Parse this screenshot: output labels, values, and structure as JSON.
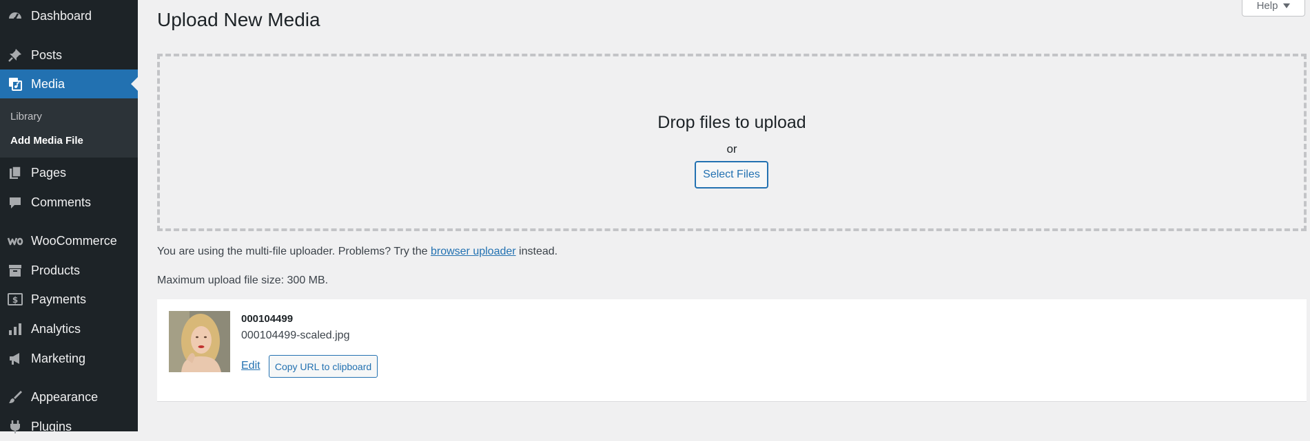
{
  "sidebar": {
    "items": [
      {
        "key": "dashboard",
        "label": "Dashboard",
        "icon": "dashboard-icon"
      },
      {
        "key": "posts",
        "label": "Posts",
        "icon": "pushpin-icon"
      },
      {
        "key": "media",
        "label": "Media",
        "icon": "media-icon"
      },
      {
        "key": "pages",
        "label": "Pages",
        "icon": "pages-icon"
      },
      {
        "key": "comments",
        "label": "Comments",
        "icon": "comment-icon"
      },
      {
        "key": "woocommerce",
        "label": "WooCommerce",
        "icon": "woocommerce-icon"
      },
      {
        "key": "products",
        "label": "Products",
        "icon": "archive-icon"
      },
      {
        "key": "payments",
        "label": "Payments",
        "icon": "money-icon"
      },
      {
        "key": "analytics",
        "label": "Analytics",
        "icon": "bar-chart-icon"
      },
      {
        "key": "marketing",
        "label": "Marketing",
        "icon": "megaphone-icon"
      },
      {
        "key": "appearance",
        "label": "Appearance",
        "icon": "paintbrush-icon"
      },
      {
        "key": "plugins",
        "label": "Plugins",
        "icon": "plug-icon"
      }
    ],
    "current": "Media",
    "submenu": {
      "library": "Library",
      "add_media": "Add Media File"
    }
  },
  "header": {
    "title": "Upload New Media",
    "help_label": "Help"
  },
  "uploader": {
    "drop_title": "Drop files to upload",
    "or_text": "or",
    "select_button": "Select Files",
    "info_prefix": "You are using the multi-file uploader. Problems? Try the",
    "info_link": "browser uploader",
    "info_suffix": "instead.",
    "max_size": "Maximum upload file size: 300 MB."
  },
  "media_item": {
    "title": "000104499",
    "filename": "000104499-scaled.jpg",
    "edit_label": "Edit",
    "copy_label": "Copy URL to clipboard"
  },
  "colors": {
    "sidebar_bg": "#1d2327",
    "accent": "#2271b1",
    "page_bg": "#f0f0f1"
  }
}
